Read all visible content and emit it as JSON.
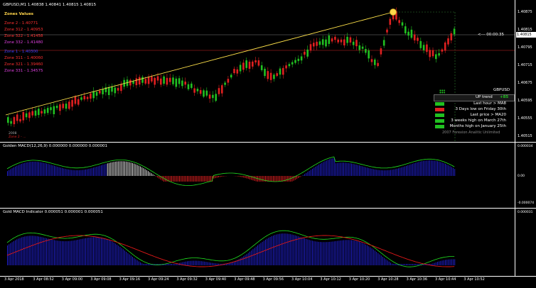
{
  "window": {
    "title": "GBPUSD,M1  1.40838 1.40841 1.40815 1.40815"
  },
  "zones": {
    "heading": "Zones Values",
    "items": [
      {
        "label": "Zone 2 - 1.40771",
        "color": "#ff3030"
      },
      {
        "label": "Zone 312 - 1.40953",
        "color": "#ff3030"
      },
      {
        "label": "Zone 322 - 1.41458",
        "color": "#ff3030"
      },
      {
        "label": "Zone 332 - 1.41480",
        "color": "#e040e0"
      },
      {
        "label": "Zone 1 - 1.40300",
        "color": "#4040ff"
      },
      {
        "label": "Zone 311 - 1.40060",
        "color": "#ff3030"
      },
      {
        "label": "Zone 321 - 1.39460",
        "color": "#ff3030"
      },
      {
        "label": "Zone 331 - 1.34575",
        "color": "#e040e0"
      }
    ]
  },
  "countdown": "<--- 00:00:35",
  "price_axis": {
    "labels": [
      "1.40875",
      "1.40815",
      "1.40795",
      "1.40715",
      "1.40675",
      "1.40595",
      "1.40555",
      "1.40515"
    ],
    "current": "1.40815"
  },
  "macd1": {
    "title": "Golden MACD(12,26,9) 0.000000 0.000000 0.000001",
    "axis": [
      "0.000034",
      "0.00",
      "-0.000074"
    ]
  },
  "macd2": {
    "title": "Gold MACD Indicator 0.000051 0.000001 0.000051",
    "axis": [
      "0.000031"
    ]
  },
  "time_axis": [
    "3 Apr 2018",
    "3 Apr 08:52",
    "3 Apr 09:00",
    "3 Apr 09:08",
    "3 Apr 09:16",
    "3 Apr 09:24",
    "3 Apr 09:32",
    "3 Apr 09:40",
    "3 Apr 09:48",
    "3 Apr 09:56",
    "3 Apr 10:04",
    "3 Apr 10:12",
    "3 Apr 10:20",
    "3 Apr 10:28",
    "3 Apr 10:36",
    "3 Apr 10:44",
    "3 Apr 10:52"
  ],
  "signal_panel": {
    "symbol": "GBPUSD",
    "trend": "UP trend",
    "score": "+85",
    "rows": [
      {
        "text": "Last hour > MA8",
        "lamp": "#21c021"
      },
      {
        "text": "3 Days low on Friday 30th",
        "lamp": "#e02020"
      },
      {
        "text": "Last price > MA20",
        "lamp": "#21c021"
      },
      {
        "text": "3 weeks high on March 27th",
        "lamp": "#21c021"
      },
      {
        "text": "Months high on January 25th",
        "lamp": "#21c021"
      }
    ],
    "footer": "2007 Forexion Analitic Unlimited"
  },
  "bottom_left": [
    "2008",
    "Zone 2 - ..."
  ],
  "colors": {
    "bull": "#21c021",
    "bear": "#e02020",
    "trendline": "#ffe24a",
    "macd_bar": "#2020d0",
    "macd_bar_white": "#e0e0e0",
    "signal_green": "#20e020",
    "signal_red": "#e01818"
  }
}
